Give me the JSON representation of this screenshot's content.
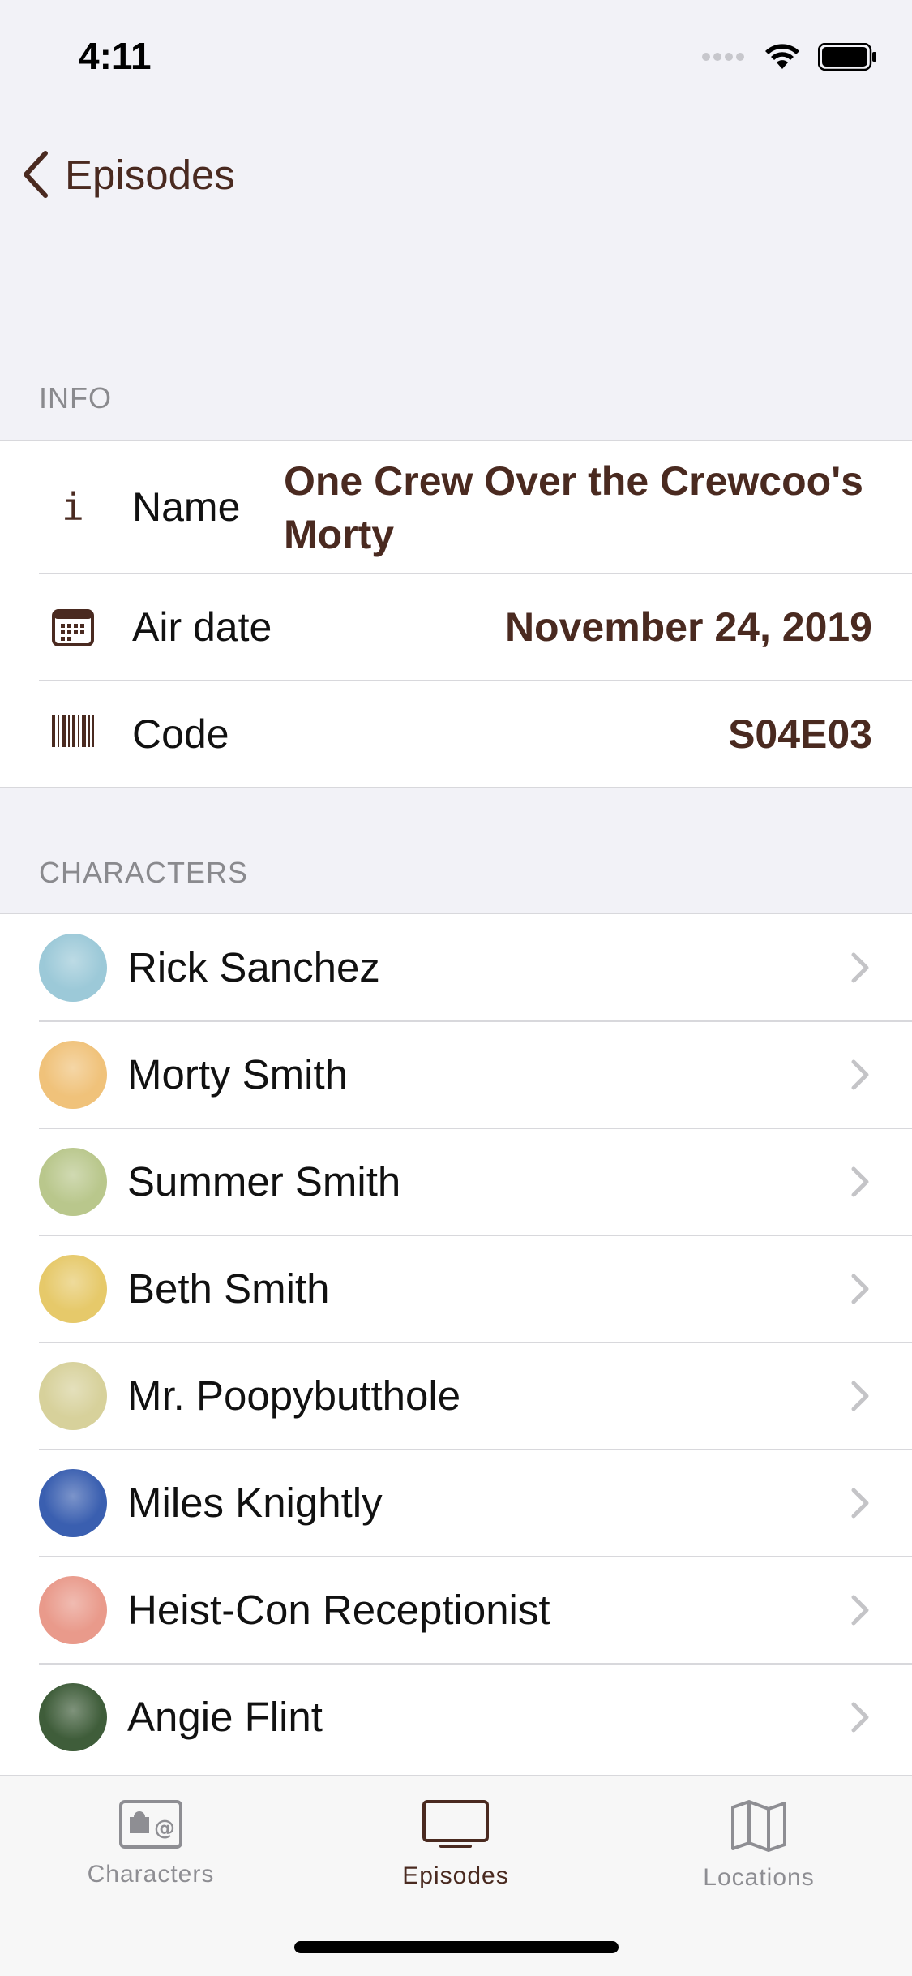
{
  "status_bar": {
    "time": "4:11"
  },
  "nav": {
    "back_label": "Episodes"
  },
  "info": {
    "header": "INFO",
    "rows": [
      {
        "label": "Name",
        "value": "One Crew Over the Crewcoo's Morty",
        "icon": "info-icon"
      },
      {
        "label": "Air date",
        "value": "November 24, 2019",
        "icon": "calendar-icon"
      },
      {
        "label": "Code",
        "value": "S04E03",
        "icon": "barcode-icon"
      }
    ]
  },
  "characters": {
    "header": "CHARACTERS",
    "items": [
      {
        "name": "Rick Sanchez",
        "avatar_color": "#9cc9d8"
      },
      {
        "name": "Morty Smith",
        "avatar_color": "#f0c27a"
      },
      {
        "name": "Summer Smith",
        "avatar_color": "#b9c78c"
      },
      {
        "name": "Beth Smith",
        "avatar_color": "#e6c96a"
      },
      {
        "name": "Mr. Poopybutthole",
        "avatar_color": "#d7d19b"
      },
      {
        "name": "Miles Knightly",
        "avatar_color": "#3a5fb0"
      },
      {
        "name": "Heist-Con Receptionist",
        "avatar_color": "#e99a8b"
      },
      {
        "name": "Angie Flint",
        "avatar_color": "#3f5d3a"
      }
    ]
  },
  "tabbar": {
    "tabs": [
      {
        "label": "Characters",
        "selected": false
      },
      {
        "label": "Episodes",
        "selected": true
      },
      {
        "label": "Locations",
        "selected": false
      }
    ]
  },
  "colors": {
    "accent": "#4a2a20",
    "inactive": "#8e8e93",
    "separator": "#d8d8dc"
  }
}
